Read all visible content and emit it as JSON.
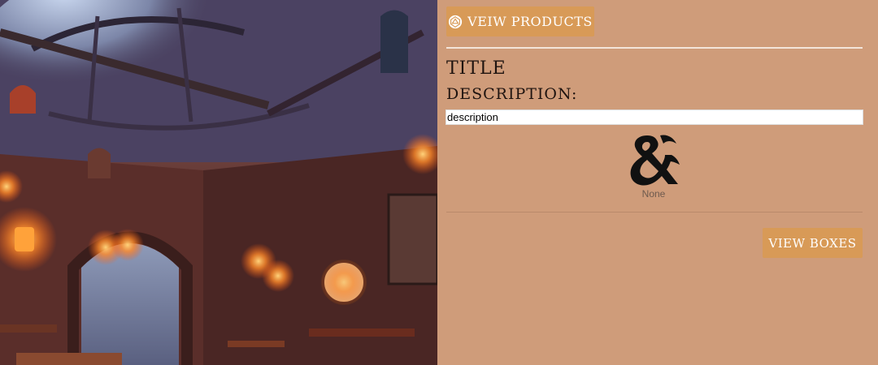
{
  "hero": {
    "icon": "tavern-illustration"
  },
  "header": {
    "products_button_label": "VEIW PRODUCTS",
    "products_button_icon": "d20-icon"
  },
  "content": {
    "title": "TITLE",
    "description_label": "DESCRIPTION:",
    "description_value": "description",
    "logo_icon": "ampersand-dragon-logo",
    "logo_caption": "None",
    "boxes_button_label": "VIEW BOXES"
  },
  "colors": {
    "panel": "#cf9c7a",
    "button": "#d89a57",
    "rule": "#f3e5da"
  }
}
